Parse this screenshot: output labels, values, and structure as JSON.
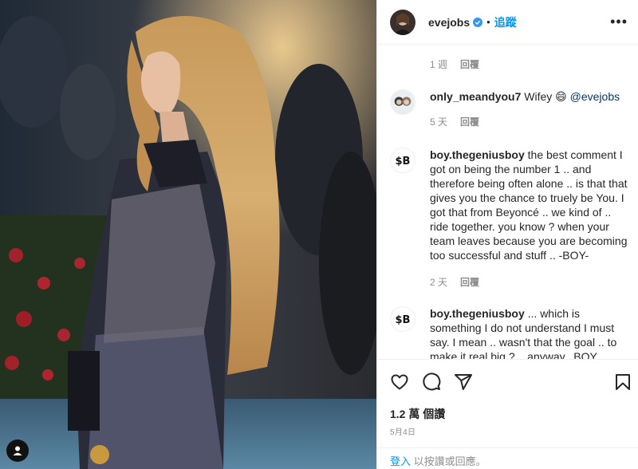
{
  "post": {
    "username": "evejobs",
    "follow_label": "追蹤",
    "separator": "•",
    "more_label": "•••"
  },
  "comments": [
    {
      "time": "1 週",
      "reply": "回覆"
    },
    {
      "user": "only_meandyou7",
      "text": "Wifey",
      "emoji": "😄",
      "mention": "@evejobs",
      "time": "5 天",
      "reply": "回覆"
    },
    {
      "user": "boy.thegeniusboy",
      "text": "the best comment I got on being the number 1 .. and therefore being often alone .. is that that gives you the chance to truely be You. I got that from Beyoncé .. we kind of .. ride together. you know ? when your team leaves because you are becoming too successful and stuff .. -BOY-",
      "time": "2 天",
      "reply": "回覆"
    },
    {
      "user": "boy.thegeniusboy",
      "text": "... which is something I do not understand I must say. I mean .. wasn't that the goal .. to make it real big ? .. anyway.. BOY"
    }
  ],
  "stats": {
    "views": "1.2 萬 個讚",
    "date": "5月4日"
  },
  "login": {
    "link": "登入",
    "text": " 以按讚或回應。"
  },
  "icons": [
    "heart-icon",
    "comment-icon",
    "share-icon",
    "bookmark-icon",
    "verified-icon",
    "more-icon"
  ],
  "colors": {
    "accent": "#0095f6",
    "verified": "#3897f0",
    "muted": "#8e8e8e"
  }
}
